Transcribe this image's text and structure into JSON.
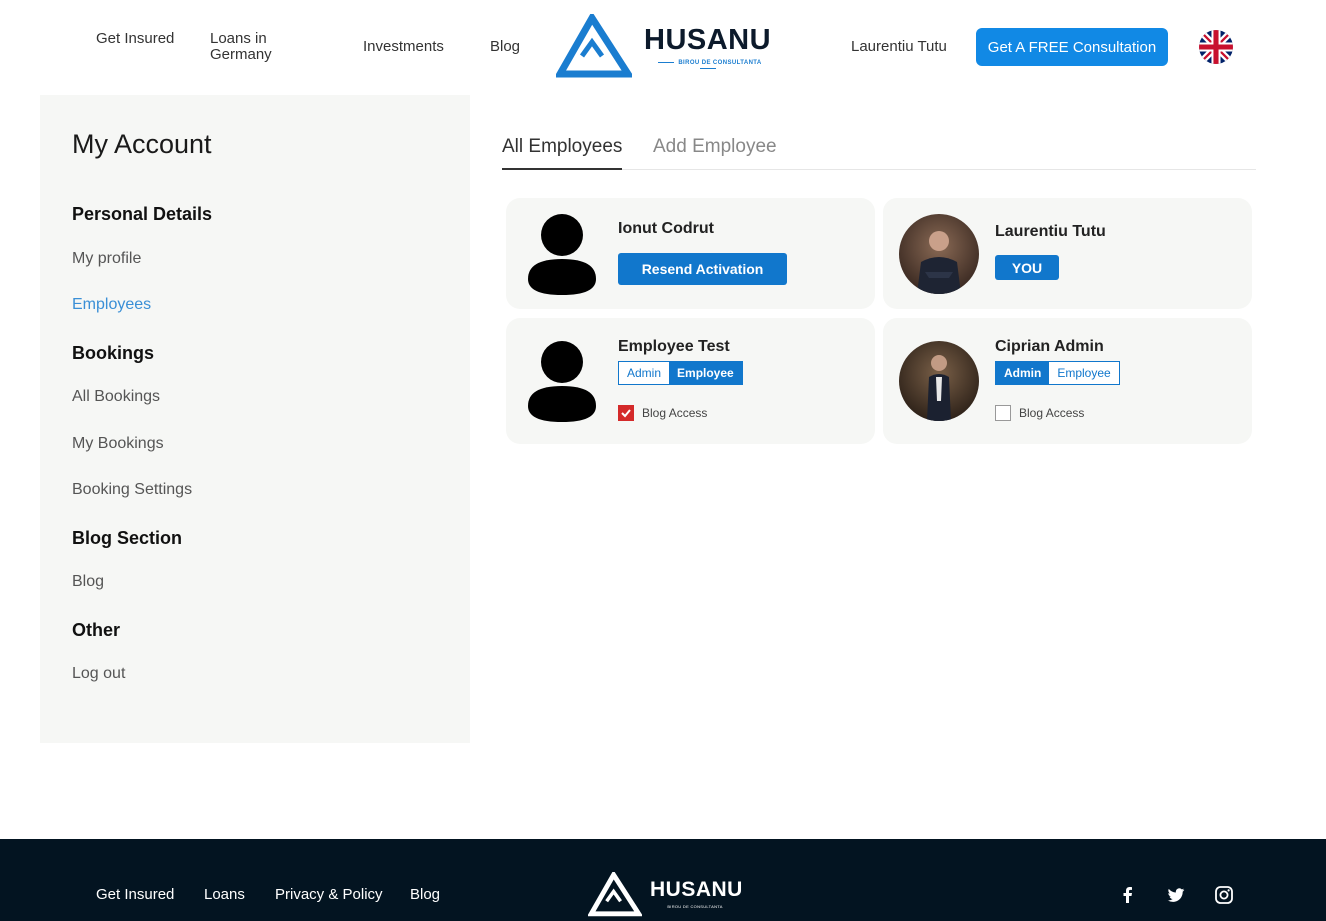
{
  "header": {
    "nav": [
      {
        "label": "Get Insured"
      },
      {
        "label": "Loans in Germany"
      },
      {
        "label": "Investments"
      },
      {
        "label": "Blog"
      }
    ],
    "logo_word": "HUSANU",
    "logo_sub": "BIROU DE CONSULTANTA",
    "user_name": "Laurentiu Tutu",
    "cta_label": "Get A FREE Consultation",
    "flag_icon": "uk-flag-icon"
  },
  "sidebar": {
    "title": "My Account",
    "sections": [
      {
        "heading": "Personal Details",
        "links": [
          "My profile",
          "Employees"
        ]
      },
      {
        "heading": "Bookings",
        "links": [
          "All Bookings",
          "My Bookings",
          "Booking Settings"
        ]
      },
      {
        "heading": "Blog Section",
        "links": [
          "Blog"
        ]
      },
      {
        "heading": "Other",
        "links": [
          "Log out"
        ]
      }
    ],
    "active_link": "Employees"
  },
  "tabs": [
    {
      "label": "All Employees",
      "active": true
    },
    {
      "label": "Add Employee",
      "active": false
    }
  ],
  "employees": [
    {
      "name": "Ionut Codrut",
      "avatar": "silhouette",
      "action_label": "Resend Activation"
    },
    {
      "name": "Laurentiu Tutu",
      "avatar": "photo",
      "badge": "YOU"
    },
    {
      "name": "Employee Test",
      "avatar": "silhouette",
      "role_options": [
        "Admin",
        "Employee"
      ],
      "selected_role": "Employee",
      "blog_access_label": "Blog Access",
      "blog_access": true
    },
    {
      "name": "Ciprian Admin",
      "avatar": "photo",
      "role_options": [
        "Admin",
        "Employee"
      ],
      "selected_role": "Admin",
      "blog_access_label": "Blog Access",
      "blog_access": false
    }
  ],
  "footer": {
    "links": [
      "Get Insured",
      "Loans",
      "Privacy & Policy",
      "Blog"
    ],
    "logo_word": "HUSANU",
    "logo_sub": "BIROU DE CONSULTANTA",
    "social_icons": [
      "facebook-icon",
      "twitter-icon",
      "instagram-icon"
    ]
  },
  "colors": {
    "primary": "#1177cc",
    "cta": "#1189e5",
    "footer_bg": "#031421",
    "sidebar_bg": "#f6f7f5",
    "checkbox_checked": "#d42a2a",
    "active_link": "#3a8fd6"
  }
}
